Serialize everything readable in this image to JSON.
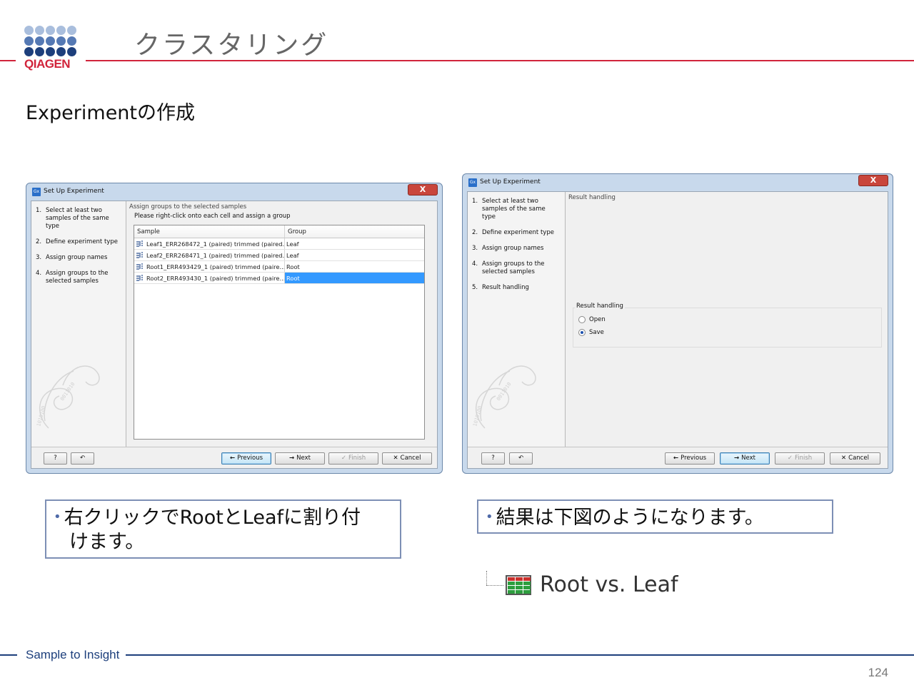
{
  "header": {
    "logo_text": "QIAGEN",
    "title": "クラスタリング",
    "subtitle": "Experimentの作成"
  },
  "dialog_left": {
    "title": "Set Up Experiment",
    "close_label": "X",
    "steps": [
      {
        "num": "1.",
        "label": "Select at least two samples of the same type"
      },
      {
        "num": "2.",
        "label": "Define experiment type"
      },
      {
        "num": "3.",
        "label": "Assign group names"
      },
      {
        "num": "4.",
        "label": "Assign groups to the selected samples"
      }
    ],
    "content_title": "Assign groups to the selected samples",
    "instruction": "Please right-click onto each cell and assign a group",
    "table": {
      "columns": [
        "Sample",
        "Group"
      ],
      "rows": [
        {
          "sample": "Leaf1_ERR268472_1 (paired) trimmed (paired...",
          "group": "Leaf"
        },
        {
          "sample": "Leaf2_ERR268471_1 (paired) trimmed (paired...",
          "group": "Leaf"
        },
        {
          "sample": "Root1_ERR493429_1 (paired) trimmed (paire...",
          "group": "Root"
        },
        {
          "sample": "Root2_ERR493430_1 (paired) trimmed (paire...",
          "group": "Root"
        }
      ],
      "selected_row": 3
    },
    "buttons": {
      "help": "?",
      "reset": "↶",
      "previous": "Previous",
      "next": "Next",
      "finish": "Finish",
      "cancel": "Cancel"
    }
  },
  "dialog_right": {
    "title": "Set Up Experiment",
    "close_label": "X",
    "steps": [
      {
        "num": "1.",
        "label": "Select at least two samples of the same type"
      },
      {
        "num": "2.",
        "label": "Define experiment type"
      },
      {
        "num": "3.",
        "label": "Assign group names"
      },
      {
        "num": "4.",
        "label": "Assign groups to the selected samples"
      },
      {
        "num": "5.",
        "label": "Result handling"
      }
    ],
    "content_title": "Result handling",
    "group_label": "Result handling",
    "options": [
      {
        "label": "Open",
        "selected": false
      },
      {
        "label": "Save",
        "selected": true
      }
    ],
    "buttons": {
      "help": "?",
      "reset": "↶",
      "previous": "Previous",
      "next": "Next",
      "finish": "Finish",
      "cancel": "Cancel"
    }
  },
  "callouts": {
    "left_line1": "右クリックでRootとLeafに割り付",
    "left_line2": "けます。",
    "right": "結果は下図のようになります。",
    "bullet": "•"
  },
  "tree_item": {
    "label": "Root vs. Leaf",
    "icon": "table-icon"
  },
  "footer": {
    "tagline": "Sample to Insight",
    "page_number": "124"
  },
  "colors": {
    "brand_red": "#d1243b",
    "brand_blue": "#1d3f7c",
    "selection_blue": "#3399ff"
  }
}
